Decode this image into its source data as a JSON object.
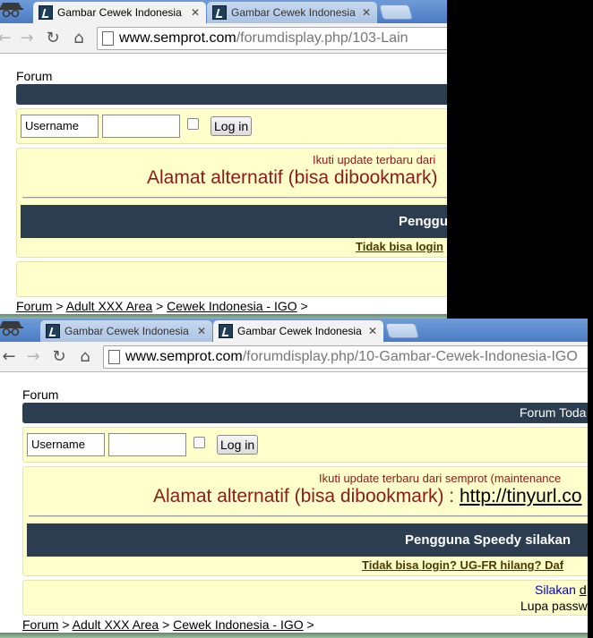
{
  "shots": [
    {
      "tabs": [
        {
          "label": "Gambar Cewek Indonesia",
          "active": true
        },
        {
          "label": "Gambar Cewek Indonesia",
          "active": false
        }
      ],
      "url_host": "www.semprot.com",
      "url_path": "/forumdisplay.php/103-Lain",
      "forum_label": "Forum",
      "navbar_links": "",
      "username_placeholder": "Username",
      "login_label": "Log in",
      "update_text": "Ikuti update terbaru dari",
      "alamat_text": "Alamat alternatif (bisa dibookmark)",
      "alamat_link": "",
      "speedy_text": "Penggu",
      "tidak_text": "Tidak bisa login",
      "silakan_text": "",
      "silakan_link": "",
      "lupa_text": "",
      "breadcrumb": [
        "Forum",
        "Adult XXX Area",
        "Cewek Indonesia - IGO"
      ],
      "breadcrumb_sep": ">"
    },
    {
      "tabs": [
        {
          "label": "Gambar Cewek Indonesia",
          "active": false
        },
        {
          "label": "Gambar Cewek Indonesia",
          "active": true
        }
      ],
      "url_host": "www.semprot.com",
      "url_path": "/forumdisplay.php/10-Gambar-Cewek-Indonesia-IGO",
      "forum_label": "Forum",
      "navbar_links": "Forum  Toda",
      "username_placeholder": "Username",
      "login_label": "Log in",
      "update_text": "Ikuti update terbaru dari semprot (maintenance",
      "alamat_text": "Alamat alternatif (bisa dibookmark) : ",
      "alamat_link": "http://tinyurl.co",
      "speedy_text": "Pengguna Speedy silakan",
      "tidak_text": "Tidak bisa login? UG-FR hilang? Daf",
      "silakan_text": "Silakan ",
      "silakan_link": "d",
      "lupa_text": "Lupa passw",
      "breadcrumb": [
        "Forum",
        "Adult XXX Area",
        "Cewek Indonesia - IGO"
      ],
      "breadcrumb_sep": ">"
    }
  ],
  "colors": {
    "navbar": "#2b3d4f",
    "notice_bg": "#ffffcc",
    "notice_text": "#8b1a1a",
    "tab_strip": "#4a7cc4"
  },
  "icons": {
    "back": "back-arrow-icon",
    "forward": "forward-arrow-icon",
    "reload": "reload-icon",
    "home": "home-icon",
    "incognito": "incognito-icon",
    "favicon": "site-favicon-icon",
    "close": "close-icon"
  }
}
